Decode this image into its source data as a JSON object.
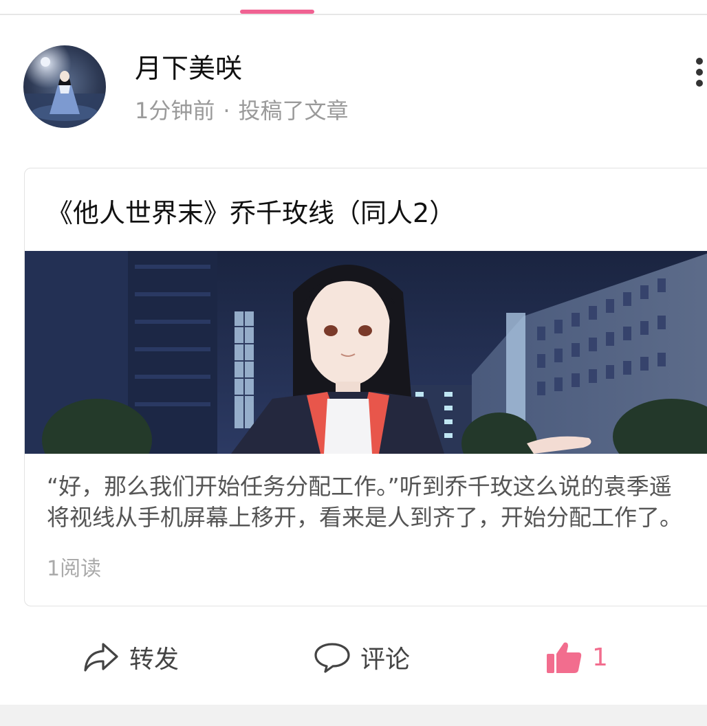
{
  "colors": {
    "accent_pink": "#f06292",
    "like_pink": "#f26d8e",
    "text_primary": "#111111",
    "text_secondary": "#9a9a9a"
  },
  "post": {
    "author_name": "月下美咲",
    "time": "1分钟前",
    "separator": "·",
    "action_text": "投稿了文章",
    "avatar_icon": "user-avatar-anime-girl",
    "more_icon": "more-vertical-icon"
  },
  "article": {
    "title": "《他人世界末》乔千玫线（同人2）",
    "cover_icon": "article-cover-image",
    "excerpt": "“好，那么我们开始任务分配工作。”听到乔千玫这么说的袁季遥将视线从手机屏幕上移开，看来是人到齐了，开始分配工作了。",
    "read_count": "1阅读"
  },
  "actions": {
    "share_label": "转发",
    "share_icon": "share-arrow-icon",
    "comment_label": "评论",
    "comment_icon": "comment-bubble-icon",
    "like_count": "1",
    "like_icon": "thumbs-up-icon"
  }
}
